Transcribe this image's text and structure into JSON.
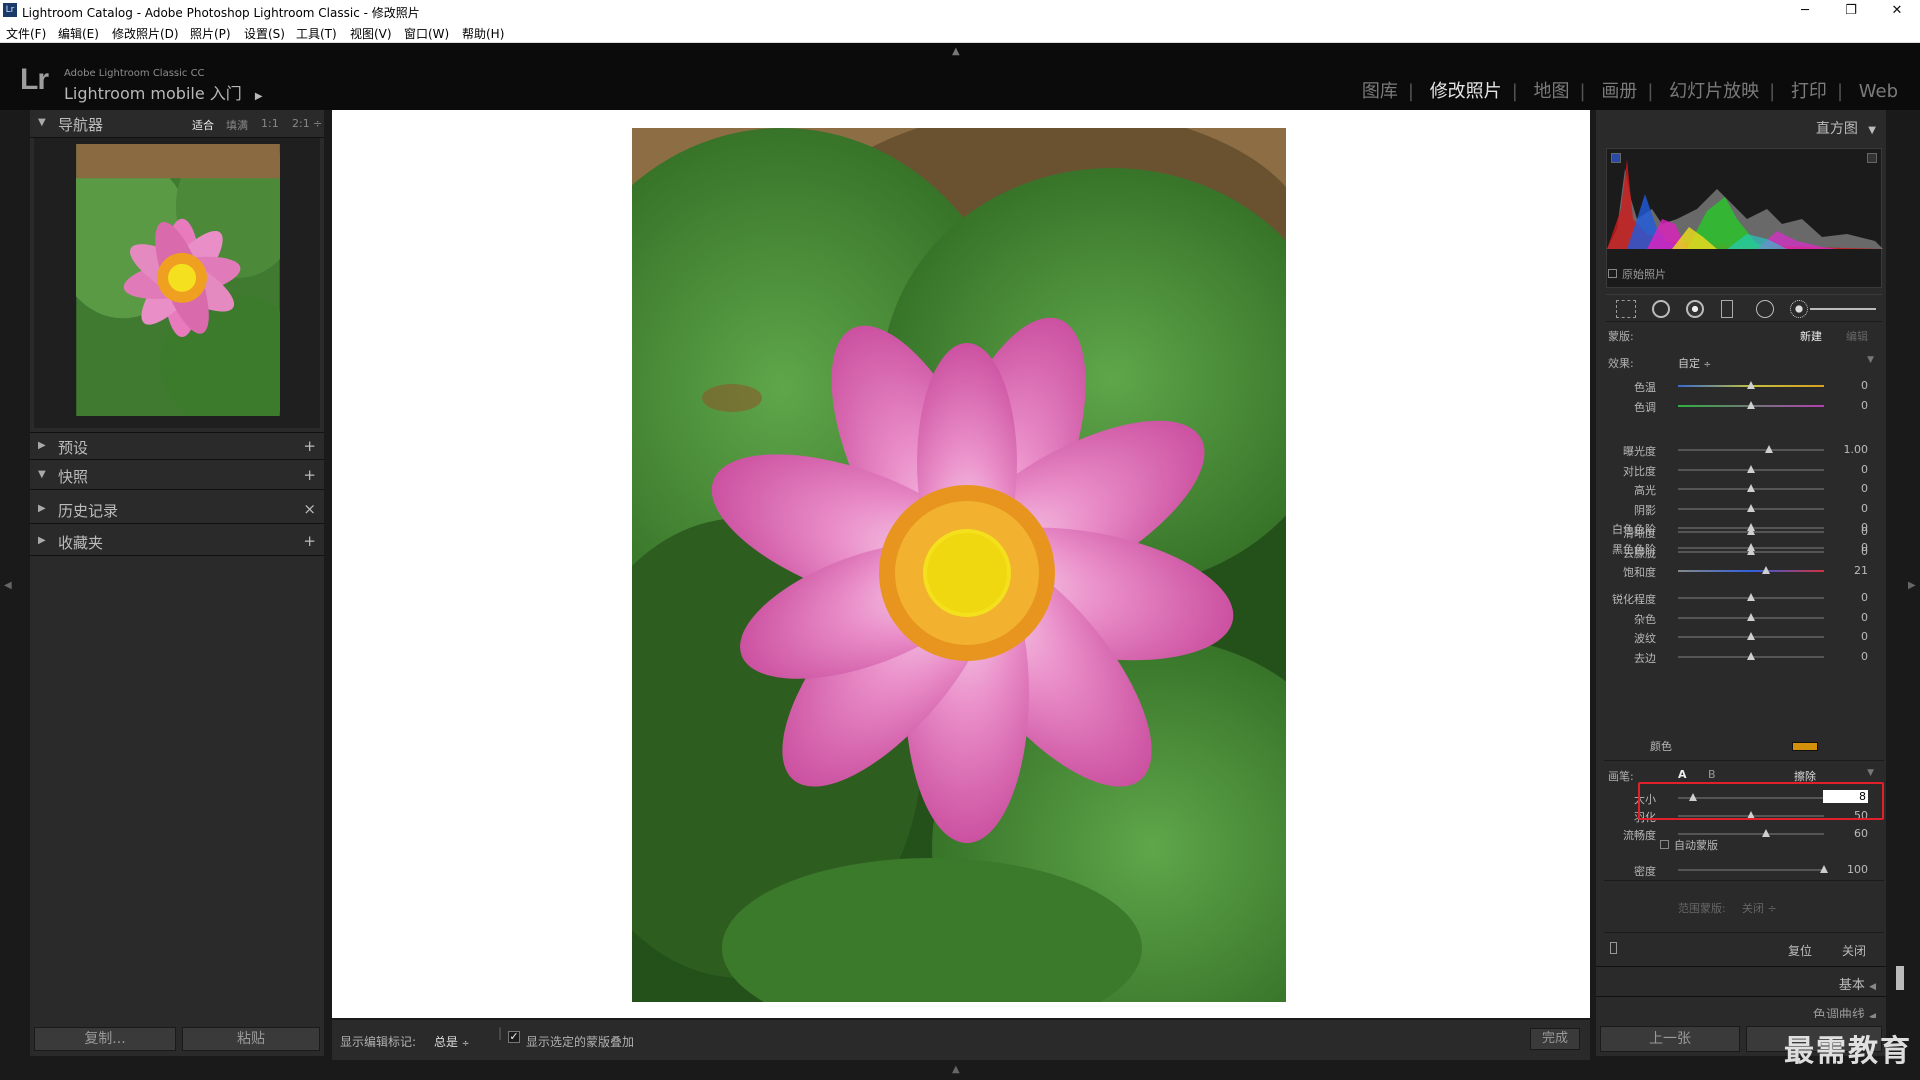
{
  "window": {
    "title": "Lightroom Catalog - Adobe Photoshop Lightroom Classic - 修改照片",
    "app_icon": "Lr",
    "minimize": "─",
    "maximize": "❐",
    "close": "✕"
  },
  "menu": [
    "文件(F)",
    "编辑(E)",
    "修改照片(D)",
    "照片(P)",
    "设置(S)",
    "工具(T)",
    "视图(V)",
    "窗口(W)",
    "帮助(H)"
  ],
  "identity": {
    "logo": "Lr",
    "product": "Adobe Lightroom Classic CC",
    "mobile": "Lightroom mobile 入门",
    "mobile_arrow": "▶"
  },
  "modules": [
    "图库",
    "修改照片",
    "地图",
    "画册",
    "幻灯片放映",
    "打印",
    "Web"
  ],
  "active_module": "修改照片",
  "left_panel": {
    "navigator": {
      "title": "导航器",
      "options": [
        "适合",
        "填满",
        "1:1",
        "2:1"
      ],
      "selected_option": "适合",
      "more": "÷"
    },
    "sections": [
      {
        "title": "预设",
        "action": "+",
        "expanded": false
      },
      {
        "title": "快照",
        "action": "+",
        "expanded": true
      },
      {
        "title": "历史记录",
        "action": "×",
        "expanded": false
      },
      {
        "title": "收藏夹",
        "action": "+",
        "expanded": false
      }
    ],
    "copy_button": "复制...",
    "paste_button": "粘贴"
  },
  "toolbar": {
    "show_edit_pins_label": "显示编辑标记:",
    "show_edit_pins_value": "总是",
    "show_edit_pins_arrow": "÷",
    "show_overlay_checked": true,
    "show_overlay_label": "显示选定的蒙版叠加",
    "done_button": "完成"
  },
  "right_panel": {
    "histogram_title": "直方图",
    "original_photo_label": "原始照片",
    "mask_label": "蒙版:",
    "mask_new": "新建",
    "mask_edit": "编辑",
    "effect_label": "效果:",
    "effect_value": "自定",
    "sliders_group1": [
      {
        "label": "色温",
        "value": "0",
        "pos": 0.5
      },
      {
        "label": "色调",
        "value": "0",
        "pos": 0.5
      }
    ],
    "sliders_group2": [
      {
        "label": "曝光度",
        "value": "1.00",
        "pos": 0.62
      },
      {
        "label": "对比度",
        "value": "0",
        "pos": 0.5
      },
      {
        "label": "高光",
        "value": "0",
        "pos": 0.5
      },
      {
        "label": "阴影",
        "value": "0",
        "pos": 0.5
      },
      {
        "label": "白色色阶",
        "value": "0",
        "pos": 0.5
      },
      {
        "label": "黑色色阶",
        "value": "0",
        "pos": 0.5
      }
    ],
    "sliders_group3": [
      {
        "label": "清晰度",
        "value": "0",
        "pos": 0.5
      },
      {
        "label": "去朦胧",
        "value": "0",
        "pos": 0.5
      },
      {
        "label": "饱和度",
        "value": "21",
        "pos": 0.6
      }
    ],
    "sliders_group4": [
      {
        "label": "锐化程度",
        "value": "0",
        "pos": 0.5
      },
      {
        "label": "杂色",
        "value": "0",
        "pos": 0.5
      },
      {
        "label": "波纹",
        "value": "0",
        "pos": 0.5
      },
      {
        "label": "去边",
        "value": "0",
        "pos": 0.5
      }
    ],
    "color_label": "颜色",
    "color_swatch": "#d4900a",
    "brush_label": "画笔:",
    "brush_a": "A",
    "brush_b": "B",
    "brush_erase": "擦除",
    "brush_sliders": [
      {
        "label": "大小",
        "value": "8",
        "pos": 0.1
      },
      {
        "label": "羽化",
        "value": "50",
        "pos": 0.5
      },
      {
        "label": "流畅度",
        "value": "60",
        "pos": 0.6
      },
      {
        "label": "密度",
        "value": "100",
        "pos": 1.0
      }
    ],
    "auto_mask_label": "自动蒙版",
    "range_mask_label": "范围蒙版:",
    "range_mask_value": "关闭",
    "reset_button": "复位",
    "close_button": "关闭",
    "basic_label": "基本",
    "tone_curve_label": "色调曲线",
    "prev_button": "上一张",
    "highlight_color": "#e0202a"
  },
  "watermark": "最需教育"
}
